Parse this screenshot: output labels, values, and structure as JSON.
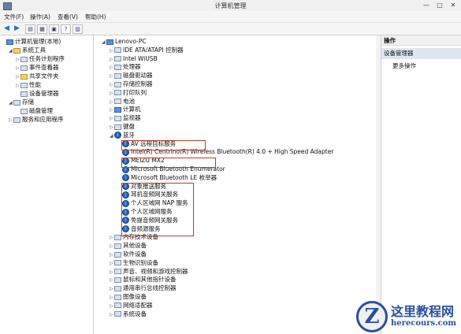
{
  "window": {
    "title": "计算机管理",
    "minimize": "—",
    "maximize": "□",
    "close": "✕"
  },
  "menu": [
    {
      "id": "file",
      "label": "文件(F)"
    },
    {
      "id": "action",
      "label": "操作(A)"
    },
    {
      "id": "view",
      "label": "查看(V)"
    },
    {
      "id": "help",
      "label": "帮助(H)"
    }
  ],
  "left_tree": [
    {
      "label": "计算机管理(本地)",
      "indent": 0,
      "expander": "",
      "icon": "computer-icon"
    },
    {
      "label": "系统工具",
      "indent": 1,
      "expander": "◢",
      "icon": "tools-icon"
    },
    {
      "label": "任务计划程序",
      "indent": 2,
      "expander": "▷",
      "icon": "clock-icon"
    },
    {
      "label": "事件查看器",
      "indent": 2,
      "expander": "▷",
      "icon": "event-icon"
    },
    {
      "label": "共享文件夹",
      "indent": 2,
      "expander": "▷",
      "icon": "folder-icon"
    },
    {
      "label": "性能",
      "indent": 2,
      "expander": "▷",
      "icon": "performance-icon"
    },
    {
      "label": "设备管理器",
      "indent": 2,
      "expander": "",
      "icon": "device-manager-icon"
    },
    {
      "label": "存储",
      "indent": 1,
      "expander": "◢",
      "icon": "storage-icon"
    },
    {
      "label": "磁盘管理",
      "indent": 2,
      "expander": "",
      "icon": "disk-icon"
    },
    {
      "label": "服务和应用程序",
      "indent": 1,
      "expander": "▷",
      "icon": "services-icon"
    }
  ],
  "device_tree": [
    {
      "label": "Lenovo-PC",
      "indent": 0,
      "expander": "◢",
      "icon": "computer-icon"
    },
    {
      "label": "IDE ATA/ATAPI 控制器",
      "indent": 1,
      "expander": "▷",
      "icon": "ide-icon"
    },
    {
      "label": "Intel WiUSB",
      "indent": 1,
      "expander": "▷",
      "icon": "usb-icon"
    },
    {
      "label": "处理器",
      "indent": 1,
      "expander": "▷",
      "icon": "cpu-icon"
    },
    {
      "label": "磁盘驱动器",
      "indent": 1,
      "expander": "▷",
      "icon": "disk-icon"
    },
    {
      "label": "存储控制器",
      "indent": 1,
      "expander": "▷",
      "icon": "storage-icon"
    },
    {
      "label": "打印队列",
      "indent": 1,
      "expander": "▷",
      "icon": "printer-icon"
    },
    {
      "label": "电池",
      "indent": 1,
      "expander": "▷",
      "icon": "battery-icon"
    },
    {
      "label": "计算机",
      "indent": 1,
      "expander": "▷",
      "icon": "computer-icon"
    },
    {
      "label": "监视器",
      "indent": 1,
      "expander": "▷",
      "icon": "monitor-icon"
    },
    {
      "label": "键盘",
      "indent": 1,
      "expander": "▷",
      "icon": "keyboard-icon"
    },
    {
      "label": "蓝牙",
      "indent": 1,
      "expander": "◢",
      "icon": "bluetooth-icon"
    },
    {
      "label": "AV 远程目标服务",
      "indent": 2,
      "expander": "",
      "icon": "bluetooth-icon"
    },
    {
      "label": "Intel(R) Centrino(R) Wireless Bluetooth(R) 4.0 + High Speed Adapter",
      "indent": 2,
      "expander": "",
      "icon": "bluetooth-icon"
    },
    {
      "label": "MEIZU MX2",
      "indent": 2,
      "expander": "",
      "icon": "bluetooth-icon"
    },
    {
      "label": "Microsoft Bluetooth Enumerator",
      "indent": 2,
      "expander": "",
      "icon": "bluetooth-icon"
    },
    {
      "label": "Microsoft Bluetooth LE 枚举器",
      "indent": 2,
      "expander": "",
      "icon": "bluetooth-icon"
    },
    {
      "label": "对象推送服务",
      "indent": 2,
      "expander": "",
      "icon": "bluetooth-icon"
    },
    {
      "label": "耳机音频网关服务",
      "indent": 2,
      "expander": "",
      "icon": "bluetooth-icon"
    },
    {
      "label": "个人区域网 NAP 服务",
      "indent": 2,
      "expander": "",
      "icon": "bluetooth-icon"
    },
    {
      "label": "个人区域网服务",
      "indent": 2,
      "expander": "",
      "icon": "bluetooth-icon"
    },
    {
      "label": "免提音频网关服务",
      "indent": 2,
      "expander": "",
      "icon": "bluetooth-icon"
    },
    {
      "label": "音频源服务",
      "indent": 2,
      "expander": "",
      "icon": "bluetooth-icon"
    },
    {
      "label": "内存技术设备",
      "indent": 1,
      "expander": "▷",
      "icon": "memory-icon"
    },
    {
      "label": "其他设备",
      "indent": 1,
      "expander": "▷",
      "icon": "other-device-icon"
    },
    {
      "label": "软件设备",
      "indent": 1,
      "expander": "▷",
      "icon": "software-device-icon"
    },
    {
      "label": "生物识别设备",
      "indent": 1,
      "expander": "▷",
      "icon": "biometric-icon"
    },
    {
      "label": "声音、视频和游戏控制器",
      "indent": 1,
      "expander": "▷",
      "icon": "sound-icon"
    },
    {
      "label": "鼠标和其他指针设备",
      "indent": 1,
      "expander": "▷",
      "icon": "mouse-icon"
    },
    {
      "label": "通用串行总线控制器",
      "indent": 1,
      "expander": "▷",
      "icon": "usb-icon"
    },
    {
      "label": "图像设备",
      "indent": 1,
      "expander": "▷",
      "icon": "camera-icon"
    },
    {
      "label": "网络适配器",
      "indent": 1,
      "expander": "▷",
      "icon": "network-icon"
    },
    {
      "label": "系统设备",
      "indent": 1,
      "expander": "▷",
      "icon": "system-icon"
    }
  ],
  "actions": {
    "header": "操作",
    "selected": "设备管理器",
    "more": "更多操作"
  },
  "watermark": {
    "title": "这里教程网",
    "url": "herecours.com",
    "logo": "Z"
  },
  "colors": {
    "highlight_box": "#c0392b",
    "bluetooth": "#1f5fb8"
  }
}
